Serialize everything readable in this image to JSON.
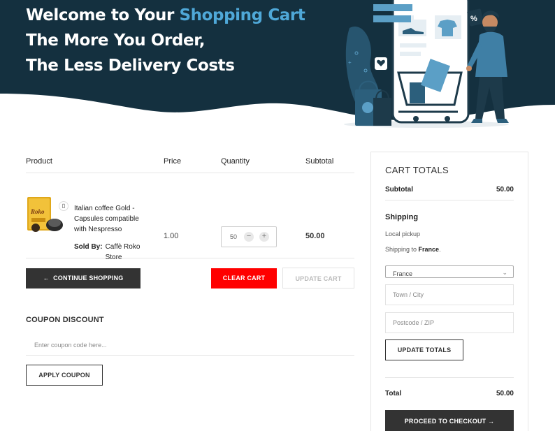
{
  "hero": {
    "line1_prefix": "Welcome to Your ",
    "line1_accent": "Shopping Cart",
    "line2": "The More You Order,",
    "line3": "The Less Delivery Costs",
    "colors": {
      "background": "#14303f",
      "accent": "#4fa8d8"
    }
  },
  "cart": {
    "columns": {
      "product": "Product",
      "price": "Price",
      "quantity": "Quantity",
      "subtotal": "Subtotal"
    },
    "items": [
      {
        "name": "Italian coffee Gold - Capsules compatible with Nespresso",
        "sold_by_label": "Sold By:",
        "store": "Caffè Roko Store",
        "price": "1.00",
        "quantity": "50",
        "subtotal": "50.00",
        "remove_icon": "phone-remove-icon"
      }
    ],
    "continue_label": "CONTINUE SHOPPING",
    "clear_label": "CLEAR CART",
    "update_label": "UPDATE CART"
  },
  "coupon": {
    "title": "COUPON DISCOUNT",
    "placeholder": "Enter coupon code here...",
    "apply_label": "APPLY COUPON"
  },
  "totals": {
    "title": "CART TOTALS",
    "subtotal_label": "Subtotal",
    "subtotal_value": "50.00",
    "shipping_label": "Shipping",
    "local_pickup": "Local pickup",
    "shipping_to_prefix": "Shipping to ",
    "shipping_to_country": "France",
    "country_selected": "France",
    "town_placeholder": "Town / City",
    "postcode_placeholder": "Postcode / ZIP",
    "update_totals_label": "UPDATE TOTALS",
    "total_label": "Total",
    "total_value": "50.00",
    "checkout_label": "PROCEED TO CHECKOUT →"
  },
  "colors": {
    "dark_button": "#333333",
    "clear_button": "#ff0000"
  }
}
